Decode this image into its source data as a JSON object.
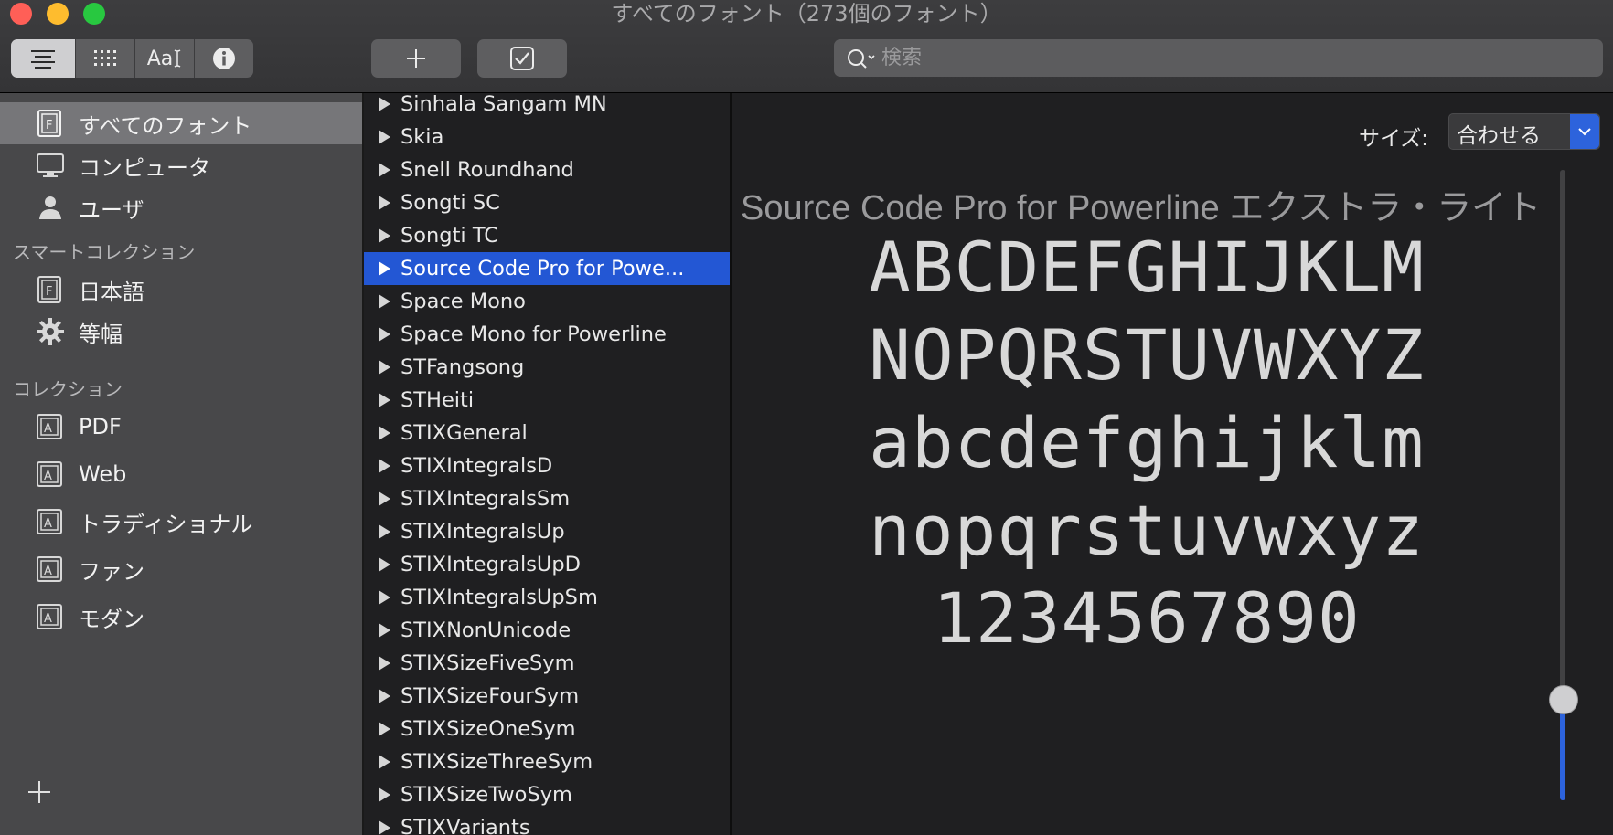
{
  "window": {
    "title": "すべてのフォント（273個のフォント）"
  },
  "toolbar": {
    "view_buttons": [
      {
        "icon": "list-lines-icon",
        "active": true
      },
      {
        "icon": "grid-icon",
        "active": false
      },
      {
        "label": "Aa",
        "icon": "text-cursor-icon",
        "active": false
      },
      {
        "icon": "info-icon",
        "active": false
      }
    ],
    "add_icon": "plus-icon",
    "check_icon": "checkbox-icon",
    "search": {
      "placeholder": "検索"
    }
  },
  "sidebar": {
    "library_items": [
      {
        "label": "すべてのフォント",
        "icon": "font-book-icon",
        "selected": true
      },
      {
        "label": "コンピュータ",
        "icon": "computer-icon",
        "selected": false
      },
      {
        "label": "ユーザ",
        "icon": "user-icon",
        "selected": false
      }
    ],
    "smart_header": "スマートコレクション",
    "smart_items": [
      {
        "label": "日本語",
        "icon": "font-book-icon"
      },
      {
        "label": "等幅",
        "icon": "gear-icon"
      }
    ],
    "collections_header": "コレクション",
    "collection_items": [
      {
        "label": "PDF",
        "icon": "collection-icon"
      },
      {
        "label": "Web",
        "icon": "collection-icon"
      },
      {
        "label": "トラディショナル",
        "icon": "collection-icon"
      },
      {
        "label": "ファン",
        "icon": "collection-icon"
      },
      {
        "label": "モダン",
        "icon": "collection-icon"
      }
    ]
  },
  "font_list": {
    "items": [
      {
        "name": "Sinhala Sangam MN",
        "selected": false
      },
      {
        "name": "Skia",
        "selected": false
      },
      {
        "name": "Snell Roundhand",
        "selected": false
      },
      {
        "name": "Songti SC",
        "selected": false
      },
      {
        "name": "Songti TC",
        "selected": false
      },
      {
        "name": "Source Code Pro for Powe...",
        "selected": true
      },
      {
        "name": "Space Mono",
        "selected": false
      },
      {
        "name": "Space Mono for Powerline",
        "selected": false
      },
      {
        "name": "STFangsong",
        "selected": false
      },
      {
        "name": "STHeiti",
        "selected": false
      },
      {
        "name": "STIXGeneral",
        "selected": false
      },
      {
        "name": "STIXIntegralsD",
        "selected": false
      },
      {
        "name": "STIXIntegralsSm",
        "selected": false
      },
      {
        "name": "STIXIntegralsUp",
        "selected": false
      },
      {
        "name": "STIXIntegralsUpD",
        "selected": false
      },
      {
        "name": "STIXIntegralsUpSm",
        "selected": false
      },
      {
        "name": "STIXNonUnicode",
        "selected": false
      },
      {
        "name": "STIXSizeFiveSym",
        "selected": false
      },
      {
        "name": "STIXSizeFourSym",
        "selected": false
      },
      {
        "name": "STIXSizeOneSym",
        "selected": false
      },
      {
        "name": "STIXSizeThreeSym",
        "selected": false
      },
      {
        "name": "STIXSizeTwoSym",
        "selected": false
      },
      {
        "name": "STIXVariants",
        "selected": false
      }
    ]
  },
  "preview": {
    "size_label": "サイズ:",
    "size_value": "合わせる",
    "font_title": "Source Code Pro for Powerline エクストラ・ライト",
    "sample_lines": [
      "ABCDEFGHIJKLM",
      "NOPQRSTUVWXYZ",
      "abcdefghijklm",
      "nopqrstuvwxyz",
      "1234567890"
    ],
    "slider_level": 0.14
  },
  "colors": {
    "accent": "#2357d4",
    "sidebar_bg": "#48484a",
    "list_bg": "#1f1f21"
  }
}
